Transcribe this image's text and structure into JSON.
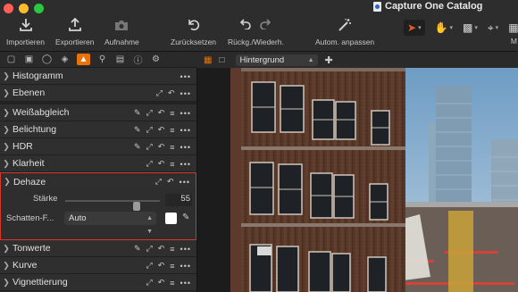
{
  "window": {
    "title": "Capture One Catalog"
  },
  "toolbar": {
    "import": "Importieren",
    "export": "Exportieren",
    "capture": "Aufnahme",
    "reset": "Zurücksetzen",
    "undo_redo": "Rückg./Wiederh.",
    "auto_adjust": "Autom. anpassen",
    "edge_letter": "M"
  },
  "panels": {
    "histogram": "Histogramm",
    "layers": "Ebenen",
    "white_balance": "Weißabgleich",
    "exposure": "Belichtung",
    "hdr": "HDR",
    "clarity": "Klarheit",
    "dehaze": "Dehaze",
    "levels": "Tonwerte",
    "curve": "Kurve",
    "vignetting": "Vignettierung"
  },
  "dehaze": {
    "amount_label": "Stärke",
    "amount_value": "55",
    "amount_fraction": 0.55,
    "shadow_label": "Schatten-F...",
    "shadow_mode": "Auto",
    "shadow_color": "#ffffff"
  },
  "viewer": {
    "variant_select": "Hintergrund"
  },
  "colors": {
    "accent": "#e8720c",
    "highlight_border": "#d9352a"
  },
  "icons": {
    "import": "download-tray-icon",
    "export": "upload-tray-icon",
    "capture": "camera-icon",
    "reset": "reset-arrow-icon",
    "undo": "undo-icon",
    "redo": "redo-icon",
    "auto_adjust": "magic-wand-icon"
  }
}
